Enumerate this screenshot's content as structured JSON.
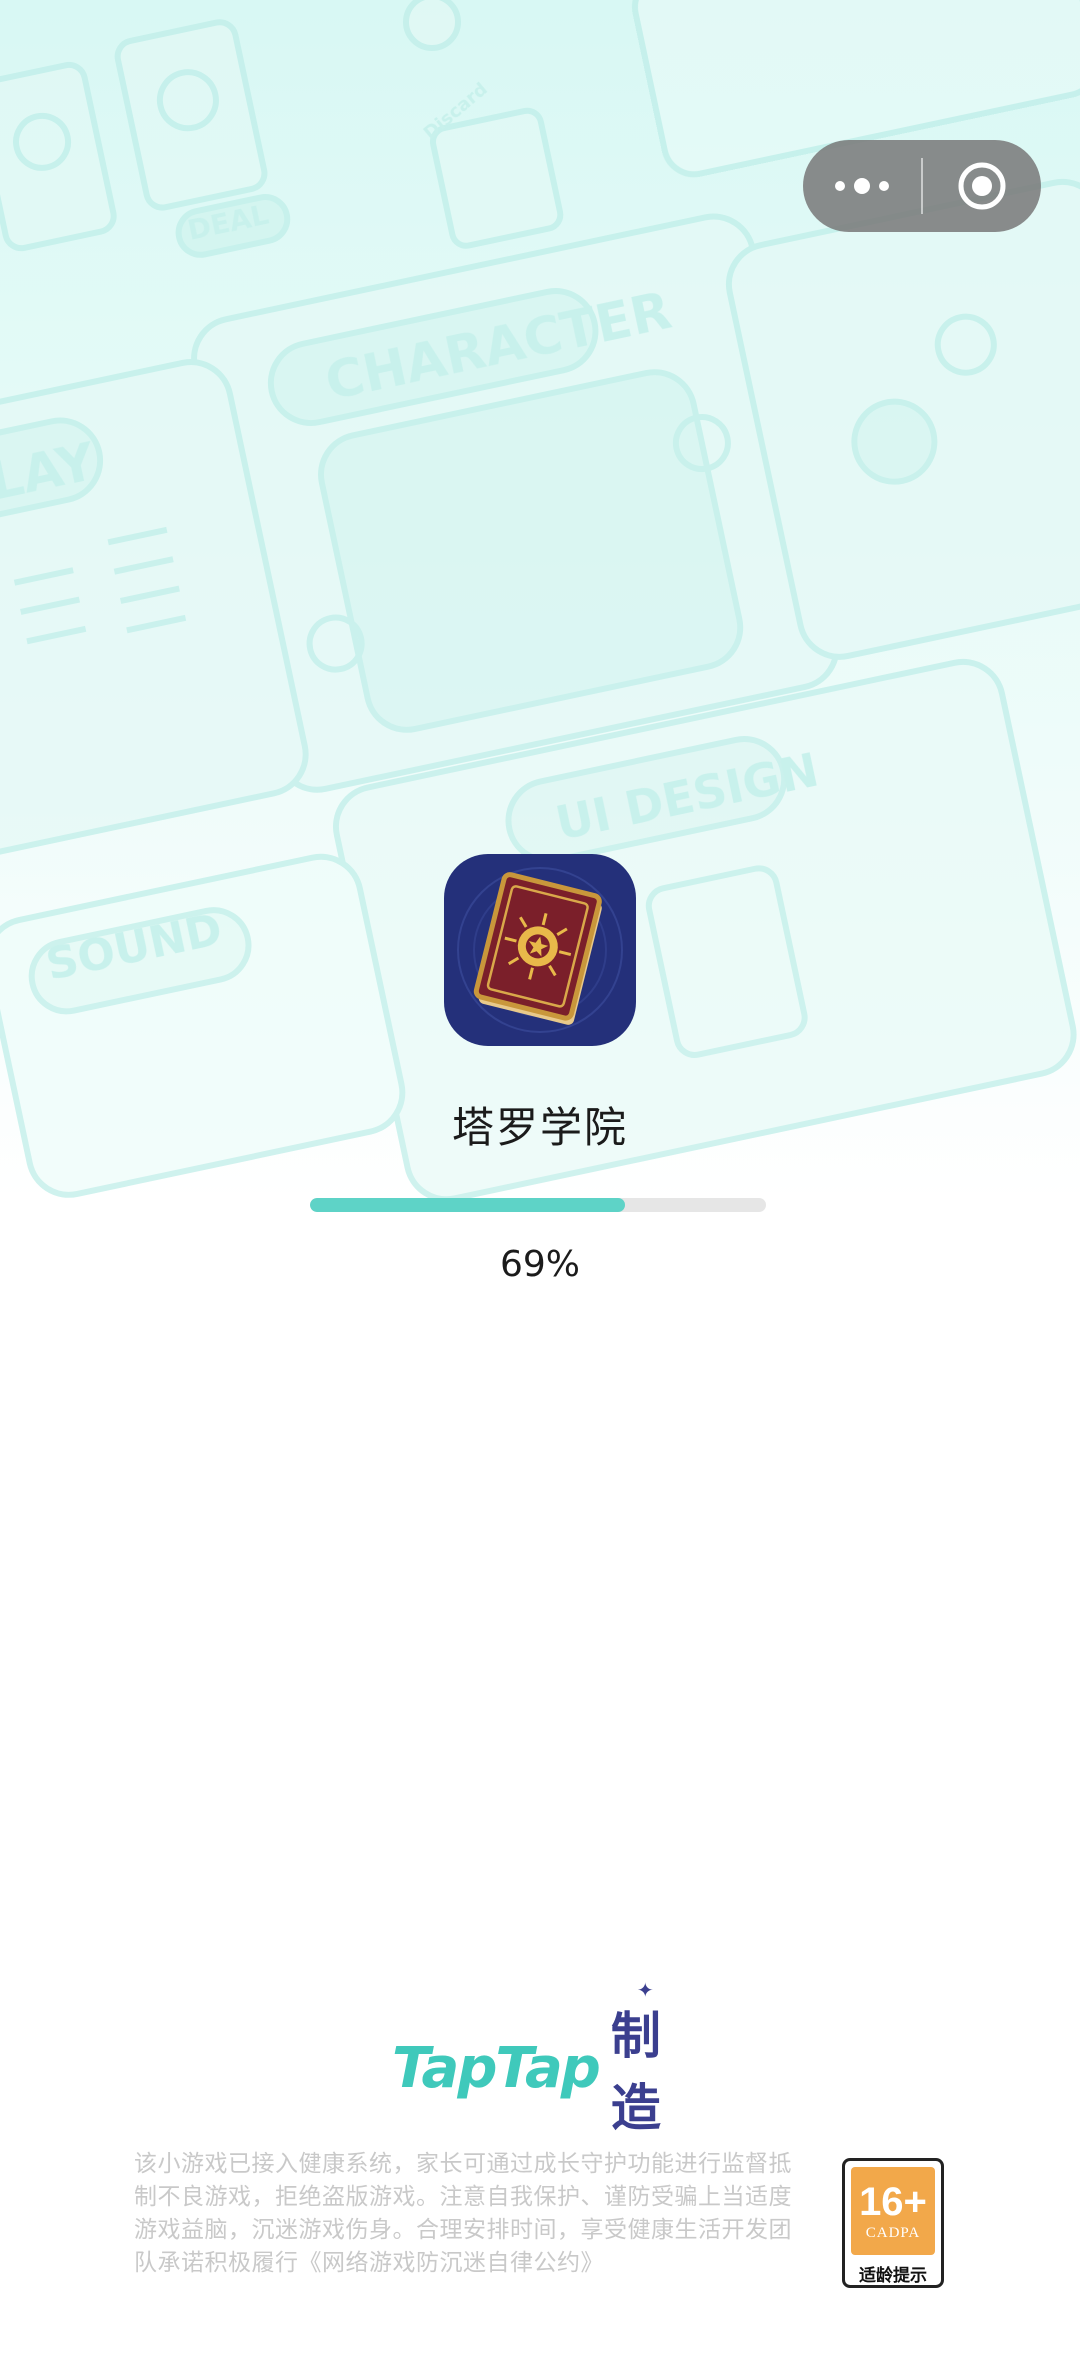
{
  "app": {
    "title": "塔罗学院",
    "progress_percent": 69,
    "progress_text": "69%"
  },
  "capsule": {
    "menu_icon": "more-dots-icon",
    "close_icon": "target-circle-icon"
  },
  "background_labels": {
    "character": "CHARACTER",
    "play": "LAY",
    "ui_design": "UI DESIGN",
    "sound": "SOUND",
    "deal": "DEAL",
    "discard": "Discard"
  },
  "brand": {
    "tap": "TapTap",
    "make": "制造"
  },
  "notice": "该小游戏已接入健康系统，家长可通过成长守护功能进行监督抵制不良游戏，拒绝盗版游戏。注意自我保护、谨防受骗上当适度游戏益脑，沉迷游戏伤身。合理安排时间，享受健康生活开发团队承诺积极履行《网络游戏防沉迷自律公约》",
  "age_rating": {
    "number": "16+",
    "org": "CADPA",
    "caption": "适龄提示"
  },
  "colors": {
    "accent": "#5ed3c7",
    "background_tint": "#e6fbf8",
    "brand_teal": "#3fc9bb",
    "brand_indigo": "#3b3f8f",
    "rating_orange": "#f2a84a"
  }
}
